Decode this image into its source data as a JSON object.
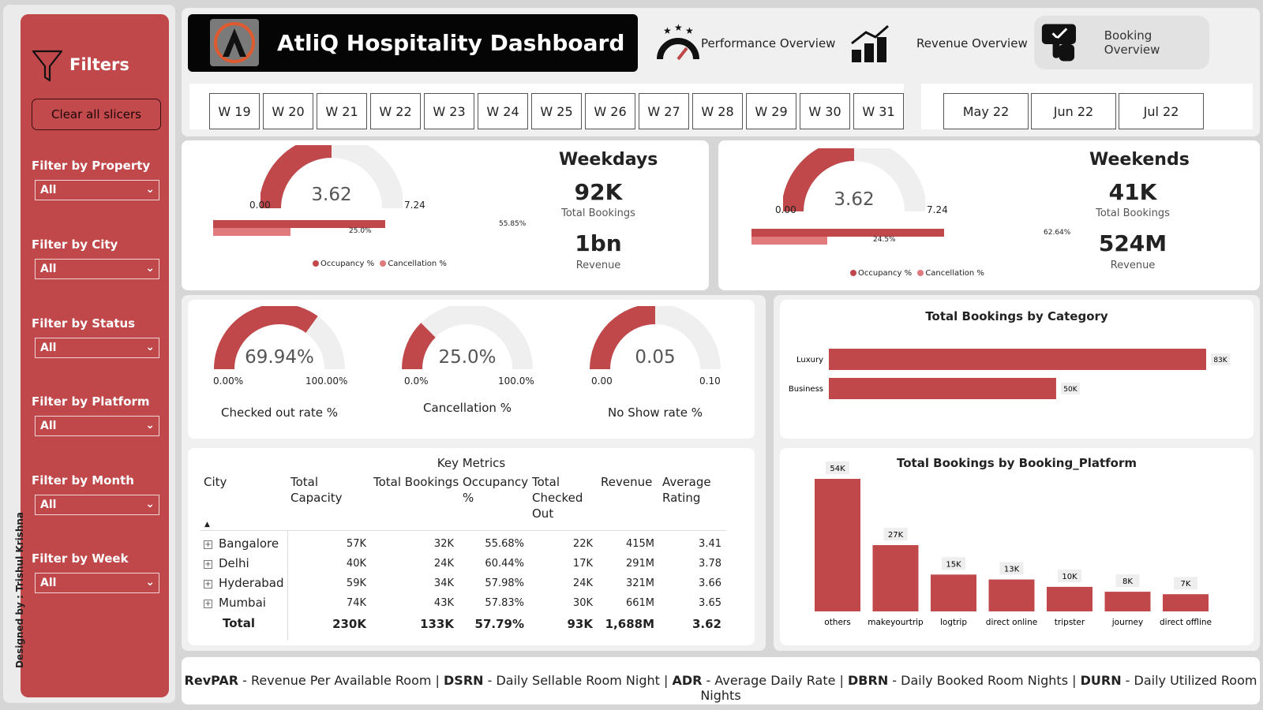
{
  "sidebar": {
    "title": "Filters",
    "clear_label": "Clear all slicers",
    "filters": [
      {
        "label": "Filter by Property",
        "value": "All"
      },
      {
        "label": "Filter by City",
        "value": "All"
      },
      {
        "label": "Filter by Status",
        "value": "All"
      },
      {
        "label": "Filter by Platform",
        "value": "All"
      },
      {
        "label": "Filter by Month",
        "value": "All"
      },
      {
        "label": "Filter by Week",
        "value": "All"
      }
    ],
    "designer": "Designed by : Trishul Krishna"
  },
  "header": {
    "title": "AtliQ Hospitality Dashboard",
    "nav": [
      "Performance Overview",
      "Revenue Overview",
      "Booking Overview"
    ],
    "weeks": [
      "W 19",
      "W 20",
      "W 21",
      "W 22",
      "W 23",
      "W 24",
      "W 25",
      "W 26",
      "W 27",
      "W 28",
      "W 29",
      "W 30",
      "W 31"
    ],
    "months": [
      "May 22",
      "Jun 22",
      "Jul 22"
    ]
  },
  "weekdays": {
    "title": "Weekdays",
    "gauge": {
      "value": "3.62",
      "min": "0.00",
      "max": "7.24",
      "fraction": 0.5
    },
    "bars": {
      "occupancy": 55.85,
      "occupancy_label": "55.85%",
      "cancellation": 25.0,
      "cancellation_label": "25.0%"
    },
    "bookings": "92K",
    "bookings_label": "Total Bookings",
    "revenue": "1bn",
    "revenue_label": "Revenue",
    "legend": [
      "Occupancy %",
      "Cancellation %"
    ]
  },
  "weekends": {
    "title": "Weekends",
    "gauge": {
      "value": "3.62",
      "min": "0.00",
      "max": "7.24",
      "fraction": 0.5
    },
    "bars": {
      "occupancy": 62.64,
      "occupancy_label": "62.64%",
      "cancellation": 24.5,
      "cancellation_label": "24.5%"
    },
    "bookings": "41K",
    "bookings_label": "Total Bookings",
    "revenue": "524M",
    "revenue_label": "Revenue",
    "legend": [
      "Occupancy %",
      "Cancellation %"
    ]
  },
  "kpis": [
    {
      "label": "Checked out rate %",
      "value": "69.94%",
      "min": "0.00%",
      "max": "100.00%",
      "fraction": 0.6994
    },
    {
      "label": "Cancellation %",
      "value": "25.0%",
      "min": "0.0%",
      "max": "100.0%",
      "fraction": 0.25
    },
    {
      "label": "No Show rate %",
      "value": "0.05",
      "min": "0.00",
      "max": "0.10",
      "fraction": 0.5
    }
  ],
  "key_metrics": {
    "title": "Key Metrics",
    "headers": [
      "City",
      "Total Capacity",
      "Total Bookings",
      "Occupancy %",
      "Total Checked Out",
      "Revenue",
      "Average Rating"
    ],
    "rows": [
      {
        "city": "Bangalore",
        "cells": [
          "57K",
          "32K",
          "55.68%",
          "22K",
          "415M",
          "3.41"
        ]
      },
      {
        "city": "Delhi",
        "cells": [
          "40K",
          "24K",
          "60.44%",
          "17K",
          "291M",
          "3.78"
        ]
      },
      {
        "city": "Hyderabad",
        "cells": [
          "59K",
          "34K",
          "57.98%",
          "24K",
          "321M",
          "3.66"
        ]
      },
      {
        "city": "Mumbai",
        "cells": [
          "74K",
          "43K",
          "57.83%",
          "30K",
          "661M",
          "3.65"
        ]
      }
    ],
    "total": {
      "city": "Total",
      "cells": [
        "230K",
        "133K",
        "57.79%",
        "93K",
        "1,688M",
        "3.62"
      ]
    }
  },
  "chart_data": [
    {
      "type": "bar",
      "orientation": "horizontal",
      "title": "Total Bookings by Category",
      "categories": [
        "Luxury",
        "Business"
      ],
      "values": [
        83000,
        50000
      ],
      "labels": [
        "83K",
        "50K"
      ]
    },
    {
      "type": "bar",
      "title": "Total Bookings by Booking_Platform",
      "categories": [
        "others",
        "makeyourtrip",
        "logtrip",
        "direct online",
        "tripster",
        "journey",
        "direct offline"
      ],
      "values": [
        54000,
        27000,
        15000,
        13000,
        10000,
        8000,
        7000
      ],
      "labels": [
        "54K",
        "27K",
        "15K",
        "13K",
        "10K",
        "8K",
        "7K"
      ]
    }
  ],
  "footer": {
    "parts": [
      {
        "abbr": "RevPAR",
        "desc": " - Revenue Per Available Room | "
      },
      {
        "abbr": "DSRN",
        "desc": " - Daily Sellable Room Night | "
      },
      {
        "abbr": "ADR",
        "desc": " - Average Daily Rate | "
      },
      {
        "abbr": "DBRN",
        "desc": " - Daily Booked Room Nights | "
      },
      {
        "abbr": "DURN",
        "desc": " - Daily Utilized Room Nights"
      }
    ]
  },
  "colors": {
    "accent": "#c0484a",
    "light": "#e07a7c",
    "track": "#efefef"
  }
}
